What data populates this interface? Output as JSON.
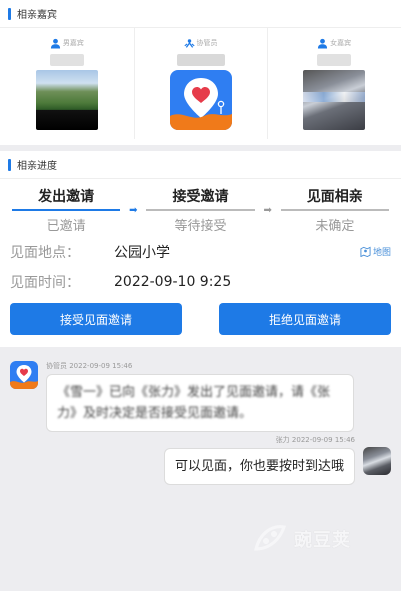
{
  "guests_section": {
    "title": "相亲嘉宾"
  },
  "guests": [
    {
      "role": "男嘉宾",
      "photo": "landscape"
    },
    {
      "role": "协管员",
      "photo": "app-icon"
    },
    {
      "role": "女嘉宾",
      "photo": "blurred"
    }
  ],
  "progress_section": {
    "title": "相亲进度"
  },
  "steps": [
    {
      "name": "发出邀请",
      "status": "已邀请"
    },
    {
      "name": "接受邀请",
      "status": "等待接受"
    },
    {
      "name": "见面相亲",
      "status": "未确定"
    }
  ],
  "details": {
    "location_label": "见面地点：",
    "location_value": "公园小学",
    "map_label": "地图",
    "time_label": "见面时间：",
    "time_value": "2022-09-10 9:25"
  },
  "actions": {
    "accept_label": "接受见面邀请",
    "reject_label": "拒绝见面邀请"
  },
  "messages": {
    "left_sender": "协管员 2022-09-09 15:46",
    "left_text": "《雪一》已向《张力》发出了见面邀请，请《张力》及时决定是否接受见面邀请。",
    "right_sender": "张力 2022-09-09 15:46",
    "right_text": "可以见面，你也要按时到达哦"
  },
  "watermark": {
    "text": "豌豆荚"
  },
  "colors": {
    "accent": "#1e7ae6",
    "app_icon_bg": "#2f7ef2",
    "heart": "#e63b4a",
    "wave": "#f07a1a"
  }
}
